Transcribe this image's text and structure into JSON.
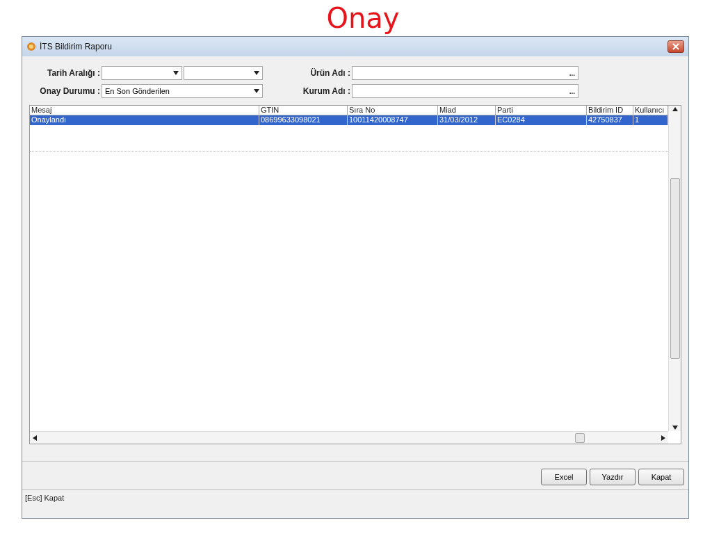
{
  "slide_title": "Onay",
  "window": {
    "title": "İTS Bildirim Raporu"
  },
  "filters": {
    "date_range": {
      "label": "Tarih Aralığı :"
    },
    "product": {
      "label": "Ürün Adı :",
      "button": "..."
    },
    "status": {
      "label": "Onay Durumu :",
      "value": "En Son Gönderilen"
    },
    "institution": {
      "label": "Kurum Adı :",
      "button": "..."
    }
  },
  "table": {
    "columns": [
      "Mesaj",
      "GTIN",
      "Sıra No",
      "Miad",
      "Parti",
      "Bildirim ID",
      "Kullanıcı"
    ],
    "rows": [
      {
        "selected": true,
        "cells": [
          "Onaylandı",
          "08699633098021",
          "10011420008747",
          "31/03/2012",
          "EC0284",
          "42750837",
          "1"
        ]
      }
    ]
  },
  "buttons": [
    "Excel",
    "Yazdır",
    "Kapat"
  ],
  "status_bar": "[Esc] Kapat"
}
